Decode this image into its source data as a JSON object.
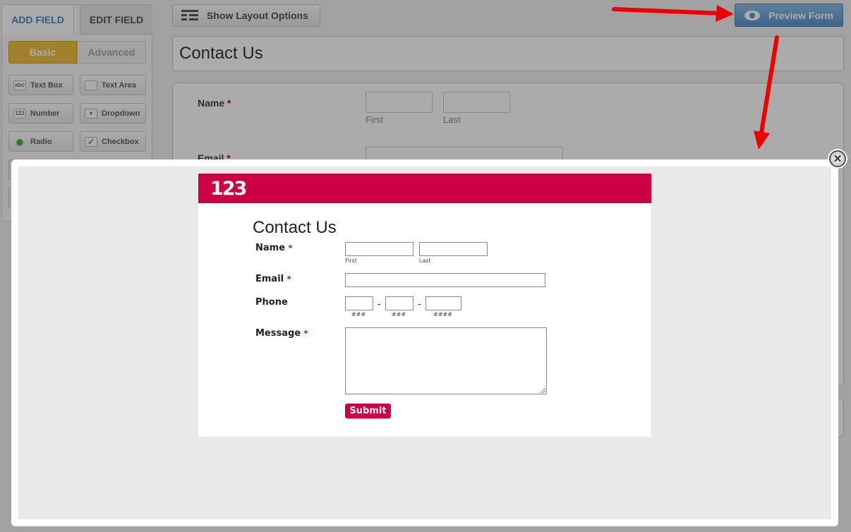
{
  "builder": {
    "tabs": [
      {
        "label": "ADD FIELD"
      },
      {
        "label": "EDIT FIELD"
      }
    ],
    "segments": [
      {
        "label": "Basic"
      },
      {
        "label": "Advanced"
      }
    ],
    "field_buttons": [
      {
        "icon_text": "abc",
        "label": "Text Box"
      },
      {
        "icon_text": "",
        "label": "Text Area"
      },
      {
        "icon_text": "123",
        "label": "Number"
      },
      {
        "icon_text": "▾",
        "label": "Dropdown"
      },
      {
        "icon_text": "◉",
        "label": "Radio"
      },
      {
        "icon_text": "✓",
        "label": "Checkbox"
      }
    ],
    "layout_button": "Show Layout Options",
    "preview_button": "Preview Form",
    "form_title": "Contact Us",
    "fields": {
      "name_label": "Name",
      "first_sub": "First",
      "last_sub": "Last",
      "email_label": "Email",
      "required_mark": "*"
    }
  },
  "modal": {
    "close_icon": "✕",
    "logo_text": "123",
    "brand_color": "#cc0044",
    "form": {
      "title": "Contact Us",
      "required_mark": "*",
      "name_label": "Name",
      "first_sub": "First",
      "last_sub": "Last",
      "email_label": "Email",
      "phone_label": "Phone",
      "phone_dash": "-",
      "phone_sub_1": "###",
      "phone_sub_2": "###",
      "phone_sub_3": "####",
      "message_label": "Message",
      "submit_label": "Submit"
    }
  },
  "annotations": {
    "arrow_color": "#ee0000"
  }
}
